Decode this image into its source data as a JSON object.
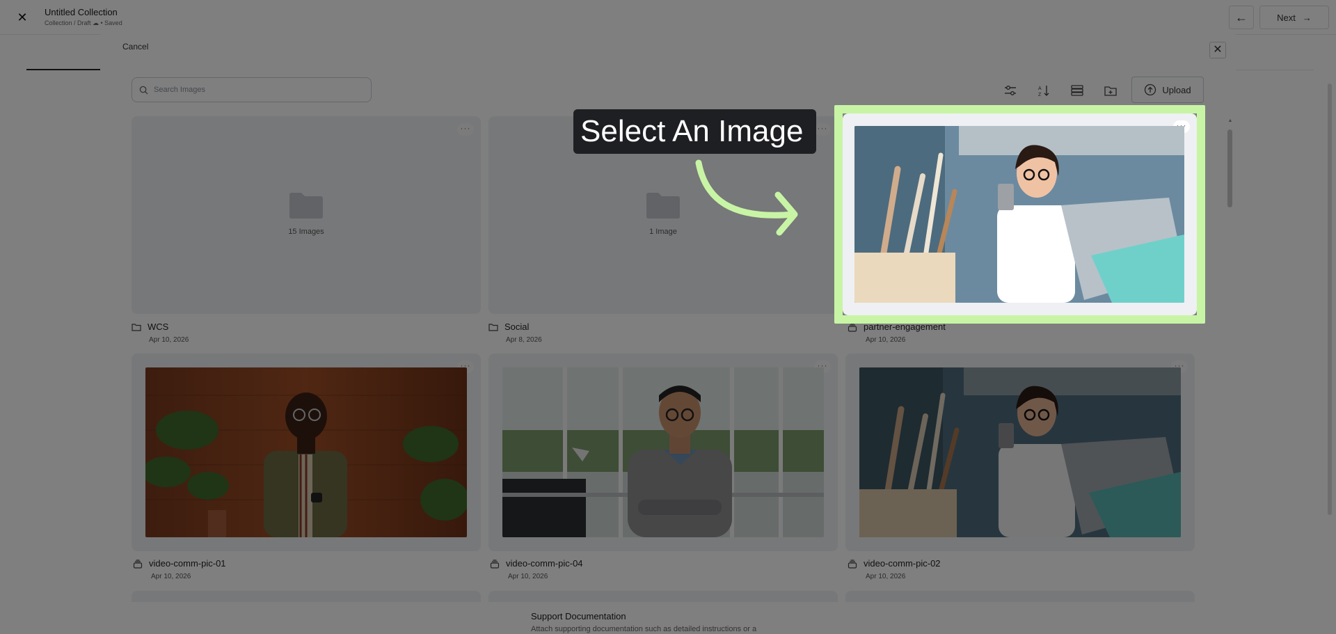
{
  "app": {
    "title": "Untitled Collection",
    "subtitle": "Collection / Draft ☁ • Saved",
    "next_label": "Next",
    "support_title": "Support Documentation",
    "support_desc": "Attach supporting documentation such as detailed instructions or a"
  },
  "modal": {
    "cancel_label": "Cancel",
    "search_placeholder": "Search Images",
    "upload_label": "Upload",
    "toolbar_icons": [
      "filter-icon",
      "sort-az-icon",
      "list-view-icon",
      "new-folder-icon",
      "upload-cloud-icon"
    ]
  },
  "items": [
    {
      "kind": "folder",
      "name": "WCS",
      "date": "Apr 10, 2026",
      "count": "15 Images"
    },
    {
      "kind": "folder",
      "name": "Social",
      "date": "Apr 8, 2026",
      "count": "1 Image"
    },
    {
      "kind": "image",
      "name": "partner-engagement",
      "date": "Apr 10, 2026"
    },
    {
      "kind": "image",
      "name": "video-comm-pic-01",
      "date": "Apr 10, 2026"
    },
    {
      "kind": "image",
      "name": "video-comm-pic-04",
      "date": "Apr 10, 2026"
    },
    {
      "kind": "image",
      "name": "video-comm-pic-02",
      "date": "Apr 10, 2026"
    }
  ],
  "tooltip": {
    "text": "Select An Image"
  },
  "colors": {
    "highlight": "#c8f5a5",
    "tooltip_bg": "#1e1f22",
    "overlay": "rgba(0,0,0,0.5)"
  }
}
